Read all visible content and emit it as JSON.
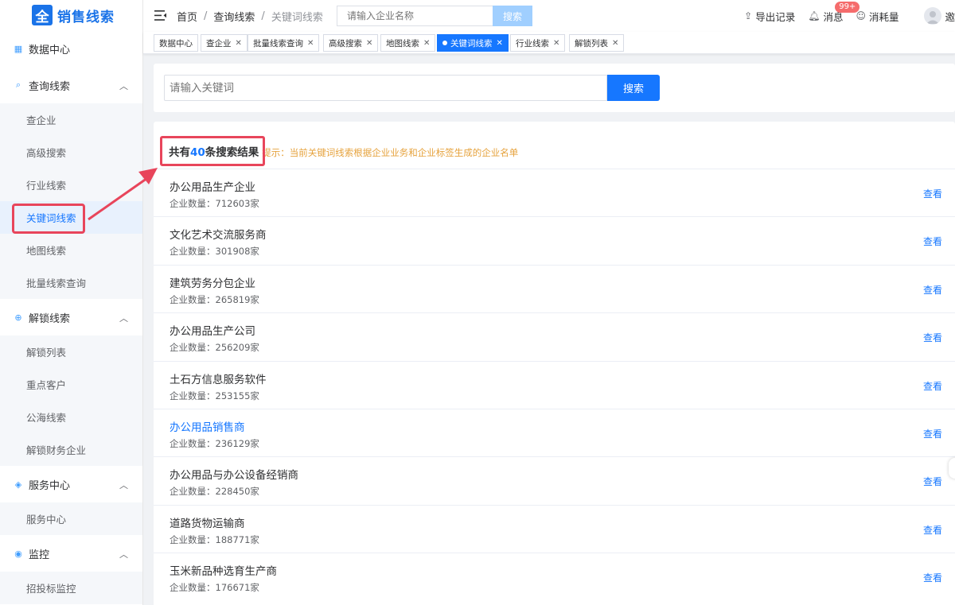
{
  "app": {
    "logo_mark": "全",
    "title": "销售线索"
  },
  "sidebar": {
    "groups": [
      {
        "label": "数据中心",
        "icon": "calendar-icon",
        "items": []
      },
      {
        "label": "查询线索",
        "icon": "search-list-icon",
        "expanded": true,
        "items": [
          "查企业",
          "高级搜索",
          "行业线索",
          "关键词线索",
          "地图线索",
          "批量线索查询"
        ]
      },
      {
        "label": "解锁线索",
        "icon": "globe-icon",
        "expanded": true,
        "items": [
          "解锁列表",
          "重点客户",
          "公海线索",
          "解锁财务企业"
        ]
      },
      {
        "label": "服务中心",
        "icon": "cube-icon",
        "expanded": true,
        "items": [
          "服务中心"
        ]
      },
      {
        "label": "监控",
        "icon": "location-icon",
        "expanded": true,
        "items": [
          "招投标监控"
        ]
      }
    ],
    "active_item": "关键词线索"
  },
  "header": {
    "breadcrumb": [
      "首页",
      "查询线索",
      "关键词线索"
    ],
    "search_placeholder": "请输入企业名称",
    "search_button": "搜索",
    "export": "导出记录",
    "messages": "消息",
    "badge": "99+",
    "consume": "消耗量",
    "avatar_text": "邀"
  },
  "tabs": [
    {
      "label": "数据中心",
      "closable": false
    },
    {
      "label": "查企业",
      "closable": true
    },
    {
      "label": "批量线索查询",
      "closable": true
    },
    {
      "label": "高级搜索",
      "closable": true
    },
    {
      "label": "地图线索",
      "closable": true
    },
    {
      "label": "关键词线索",
      "closable": true,
      "active": true
    },
    {
      "label": "行业线索",
      "closable": true
    },
    {
      "label": "解锁列表",
      "closable": true
    }
  ],
  "keyword_search": {
    "placeholder": "请输入关键词",
    "button": "搜索"
  },
  "results": {
    "prefix": "共有",
    "count": "40",
    "suffix": "条搜索结果",
    "hint": "提示：当前关键词线索根据企业业务和企业标签生成的企业名单",
    "count_label": "企业数量：",
    "unit": "家",
    "view_label": "查看",
    "items": [
      {
        "name": "办公用品生产企业",
        "count": "712603",
        "hover": false
      },
      {
        "name": "文化艺术交流服务商",
        "count": "301908",
        "hover": false
      },
      {
        "name": "建筑劳务分包企业",
        "count": "265819",
        "hover": false
      },
      {
        "name": "办公用品生产公司",
        "count": "256209",
        "hover": false
      },
      {
        "name": "土石方信息服务软件",
        "count": "253155",
        "hover": false
      },
      {
        "name": "办公用品销售商",
        "count": "236129",
        "hover": true
      },
      {
        "name": "办公用品与办公设备经销商",
        "count": "228450",
        "hover": false
      },
      {
        "name": "道路货物运输商",
        "count": "188771",
        "hover": false
      },
      {
        "name": "玉米新品种选育生产商",
        "count": "176671",
        "hover": false
      }
    ]
  },
  "colors": {
    "primary": "#1677ff",
    "highlight": "#e8455b",
    "hint": "#e6a23c"
  }
}
